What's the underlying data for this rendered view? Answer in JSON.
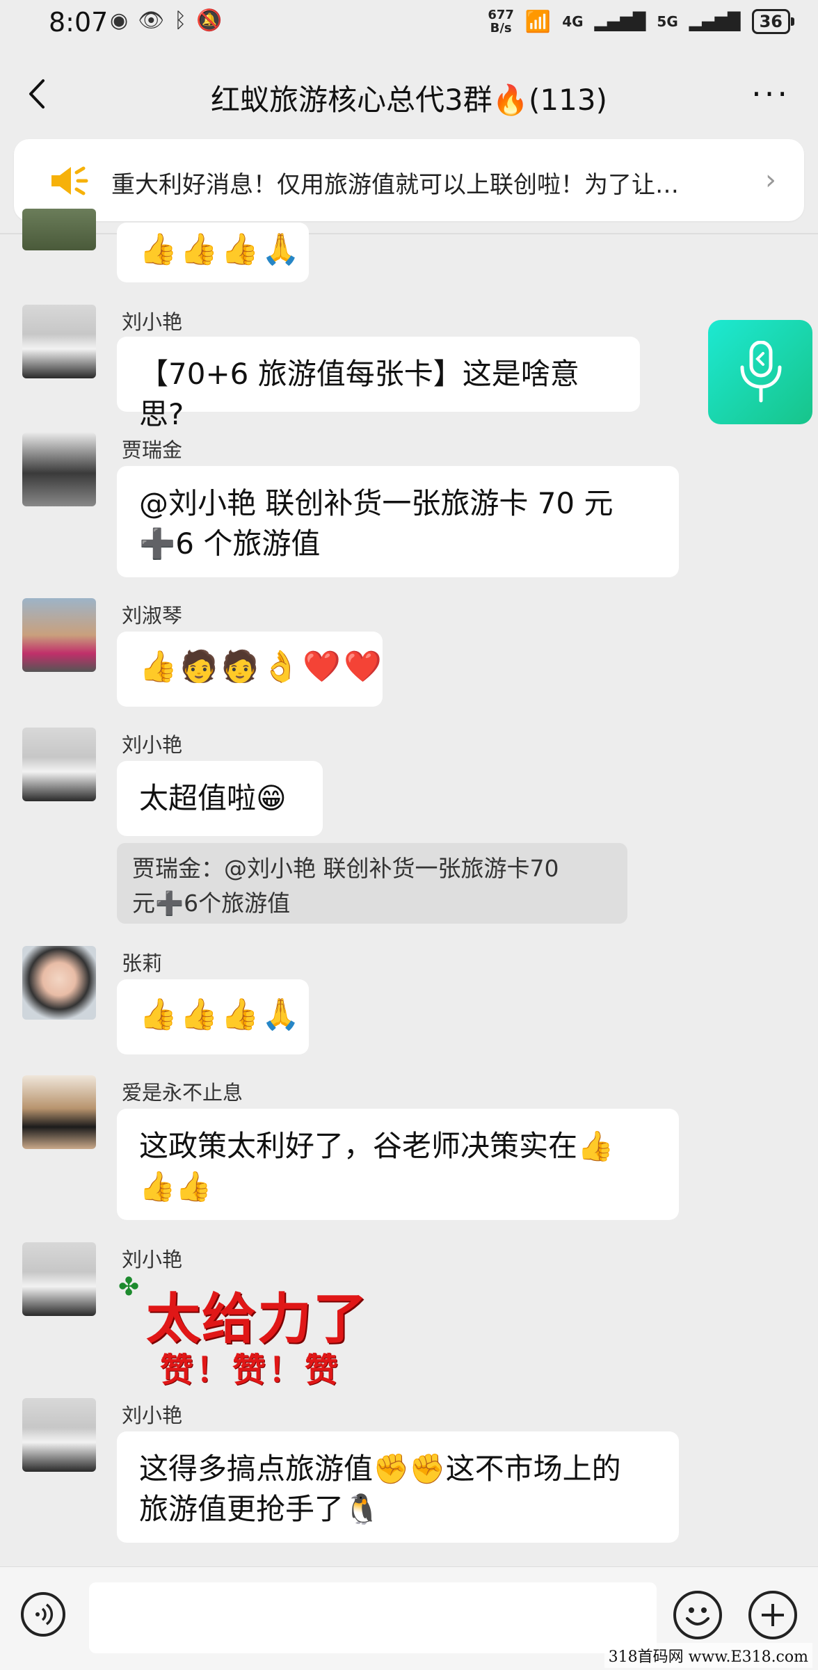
{
  "status": {
    "time": "8:07",
    "net_speed_value": "677",
    "net_speed_unit": "B/s",
    "sig1": "4G",
    "sig2": "5G",
    "battery": "36"
  },
  "header": {
    "title": "红蚁旅游核心总代3群🔥(113)",
    "more": "···"
  },
  "notice": {
    "text": "重大利好消息！仅用旅游值就可以上联创啦！为了让…"
  },
  "messages": [
    {
      "emoji": [
        "👍",
        "👍",
        "👍",
        "🙏"
      ]
    },
    {
      "sender": "刘小艳",
      "text": "【70+6 旅游值每张卡】这是啥意思?"
    },
    {
      "sender": "贾瑞金",
      "line1": "@刘小艳  联创补货一张旅游卡 70 元",
      "line2": "➕6 个旅游值"
    },
    {
      "sender": "刘淑琴",
      "emoji": [
        "👍",
        "🧑",
        "🧑",
        "👌",
        "❤️",
        "❤️"
      ]
    },
    {
      "sender": "刘小艳",
      "text": "太超值啦😁",
      "quote1": "贾瑞金：@刘小艳 联创补货一张旅游卡70",
      "quote2": "元➕6个旅游值"
    },
    {
      "sender": "张莉",
      "emoji": [
        "👍",
        "👍",
        "👍",
        "🙏"
      ]
    },
    {
      "sender": "爱是永不止息",
      "line1": "这政策太利好了，谷老师决策实在👍",
      "line2": "👍👍"
    },
    {
      "sender": "刘小艳",
      "sticker_big": "太给力了",
      "sticker_small": "赞！赞！赞"
    },
    {
      "sender": "刘小艳",
      "line1": "这得多搞点旅游值✊✊这不市场上的",
      "line2": "旅游值更抢手了🐧"
    }
  ],
  "watermark": "318首码网 www.E318.com",
  "colors": {
    "background": "#ededed",
    "bubble": "#ffffff",
    "quote": "#dedede",
    "fab": "#17c48a",
    "speaker": "#f6b10a"
  }
}
